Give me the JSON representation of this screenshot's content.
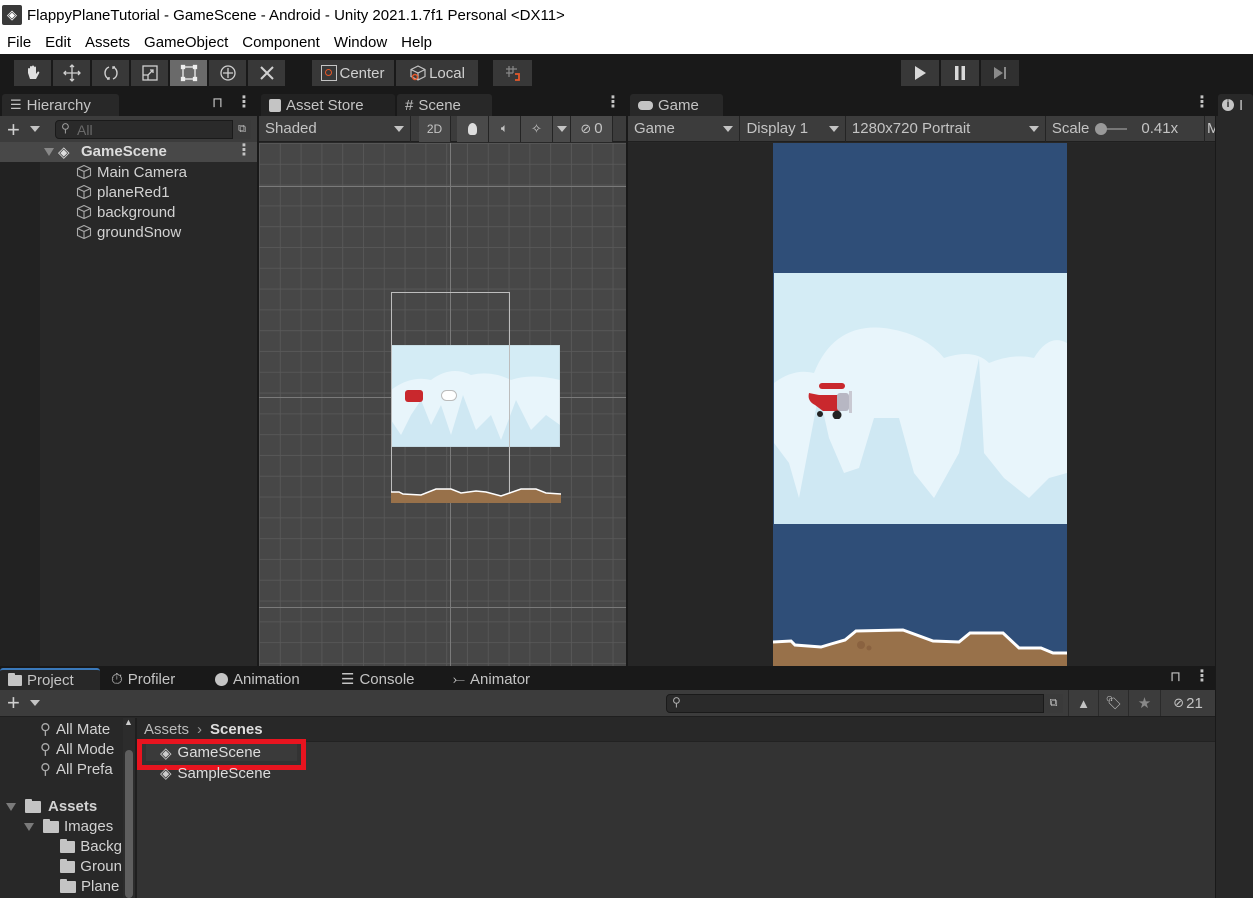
{
  "window": {
    "title": "FlappyPlaneTutorial - GameScene - Android - Unity 2021.1.7f1 Personal <DX11>"
  },
  "menu": [
    "File",
    "Edit",
    "Assets",
    "GameObject",
    "Component",
    "Window",
    "Help"
  ],
  "toolbar": {
    "tools": [
      {
        "name": "hand-tool",
        "icon": "hand-icon"
      },
      {
        "name": "move-tool",
        "icon": "move-icon"
      },
      {
        "name": "rotate-tool",
        "icon": "rotate-icon"
      },
      {
        "name": "scale-tool",
        "icon": "scale-icon"
      },
      {
        "name": "rect-tool",
        "icon": "rect-icon",
        "active": true
      },
      {
        "name": "transform-tool",
        "icon": "transform-icon"
      },
      {
        "name": "custom-tool",
        "icon": "tools-icon"
      }
    ],
    "pivot_label": "Center",
    "space_label": "Local",
    "snap_icon": "grid-snap-icon",
    "play_controls": [
      "play",
      "pause",
      "step"
    ]
  },
  "hierarchy": {
    "tab_label": "Hierarchy",
    "search_placeholder": "All",
    "scene_name": "GameScene",
    "objects": [
      "Main Camera",
      "planeRed1",
      "background",
      "groundSnow"
    ]
  },
  "scene_view": {
    "tabs": [
      "Asset Store",
      "Scene"
    ],
    "active_tab": "Scene",
    "shading_mode": "Shaded",
    "mode_2d_label": "2D",
    "hidden_count": "0"
  },
  "game_view": {
    "tab_label": "Game",
    "view_mode": "Game",
    "display": "Display 1",
    "resolution": "1280x720 Portrait",
    "scale_label": "Scale",
    "scale_value": "0.41x",
    "scale_slider_fraction": 0.0,
    "overflow_label": "M"
  },
  "inspector": {
    "tab_label": "I"
  },
  "bottom_panel": {
    "tabs": [
      "Project",
      "Profiler",
      "Animation",
      "Console",
      "Animator"
    ],
    "active_tab": "Project",
    "search_placeholder": "",
    "hidden_packages_count": "21",
    "favorites": [
      "All Materials",
      "All Models",
      "All Prefabs"
    ],
    "favorites_visible": [
      "All Mate",
      "All Mode",
      "All Prefa"
    ],
    "tree": {
      "root": "Assets",
      "children": [
        {
          "name": "Images",
          "children": [
            "Backg",
            "Groun",
            "Plane"
          ]
        }
      ]
    },
    "breadcrumb": [
      "Assets",
      "Scenes"
    ],
    "files": [
      {
        "name": "GameScene",
        "highlighted": true
      },
      {
        "name": "SampleScene",
        "highlighted": false
      }
    ],
    "highlight_color": "#e8141f"
  },
  "colors": {
    "editor_bg": "#191919",
    "panel_bg": "#282828",
    "toolbar_bg": "#3c3c3c",
    "game_bg": "#2f4e78",
    "sky": "#d4ecf5",
    "ground": "#98714a"
  }
}
